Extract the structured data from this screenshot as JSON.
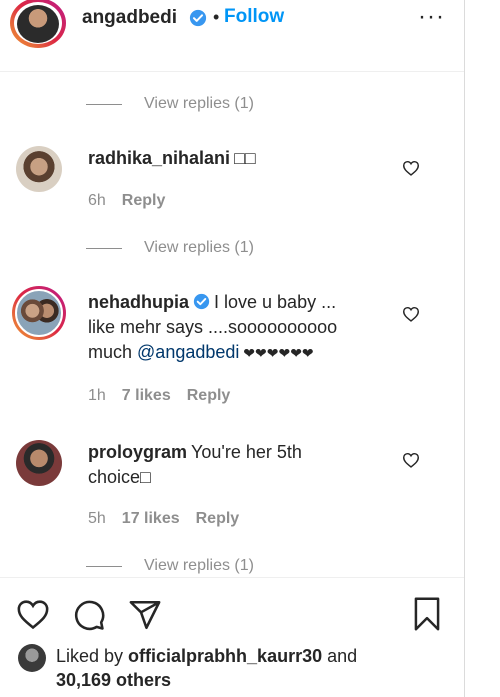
{
  "header": {
    "username": "angadbedi",
    "separator": "•",
    "follow_label": "Follow",
    "more_label": "···"
  },
  "view_replies": {
    "label": "View replies (1)"
  },
  "comments": [
    {
      "username": "radhika_nihalani",
      "text": "□□",
      "time": "6h",
      "likes": "",
      "reply": "Reply"
    },
    {
      "username": "nehadhupia",
      "text_line1": "I love u baby ...",
      "text_line2": "like mehr says ....soooooooooo",
      "text_line3_prefix": "much ",
      "mention": "@angadbedi",
      "text_line3_suffix": " ❤❤❤❤❤❤",
      "time": "1h",
      "likes": "7 likes",
      "reply": "Reply"
    },
    {
      "username": "proloygram",
      "text_line1": "You're her 5th",
      "text_line2": "choice□",
      "time": "5h",
      "likes": "17 likes",
      "reply": "Reply"
    }
  ],
  "liked_by": {
    "prefix": "Liked by ",
    "user": "officialprabhh_kaurr30",
    "middle": " and",
    "count": "30,169 others"
  },
  "colors": {
    "follow": "#0095f6",
    "verified": "#3897f0",
    "muted": "#8e8e8e",
    "mention": "#00376b"
  }
}
